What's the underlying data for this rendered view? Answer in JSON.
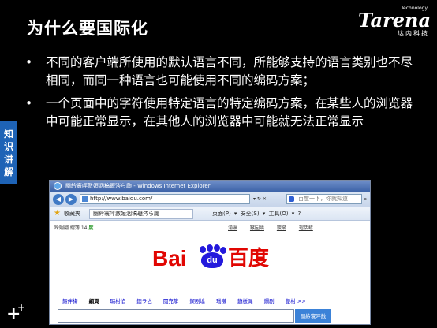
{
  "slide": {
    "title": "为什么要国际化",
    "logo": {
      "word": "Tarena",
      "tagline": "Technology",
      "chinese": "达内科技"
    },
    "side_tag": [
      "知",
      "识",
      "讲",
      "解"
    ],
    "bullets": [
      "不同的客户端所使用的默认语言不同，所能够支持的语言类别也不尽相同，而同一种语言也可能使用不同的编码方案；",
      "一个页面中的字符使用特定语言的特定编码方案，在某些人的浏览器中可能正常显示，在其他人的浏览器中可能就无法正常显示"
    ],
    "bullet_glyph": "•"
  },
  "browser": {
    "title": "圝紟寰呯敾姮洇稿瓑涔ら瓟 - Windows Internet Explorer",
    "address": "http://www.baidu.com/",
    "search_placeholder": "百度一下，你就知道",
    "favorites_label": "收藏夹",
    "tab_title": "圝紟寰呯敾姮洇稿瓑涔ら瓟",
    "toolbar_tools": "页面(P) ▾  安全(S) ▾  工具(O) ▾  ?",
    "page": {
      "top_left": "跺娴翻 緭簿 14",
      "top_left_badge": "度",
      "top_links": [
        "渝瀛",
        "鏃囩墖",
        "鍐欒",
        "瑁佸嵃"
      ],
      "logo": {
        "bai": "Bai",
        "du_paw": "du",
        "chinese": "百度"
      },
      "tabs": [
        "鏂伴椈",
        "網頁",
        "璐村惂",
        "鐭ラ亾",
        "闊充箰",
        "鍥剧墖",
        "瑙嗛",
        "鍦板浘",
        "鐧剧",
        "鏇村 >>"
      ],
      "active_tab_index": 1,
      "search_button": "圝紟寰呯敾"
    }
  }
}
